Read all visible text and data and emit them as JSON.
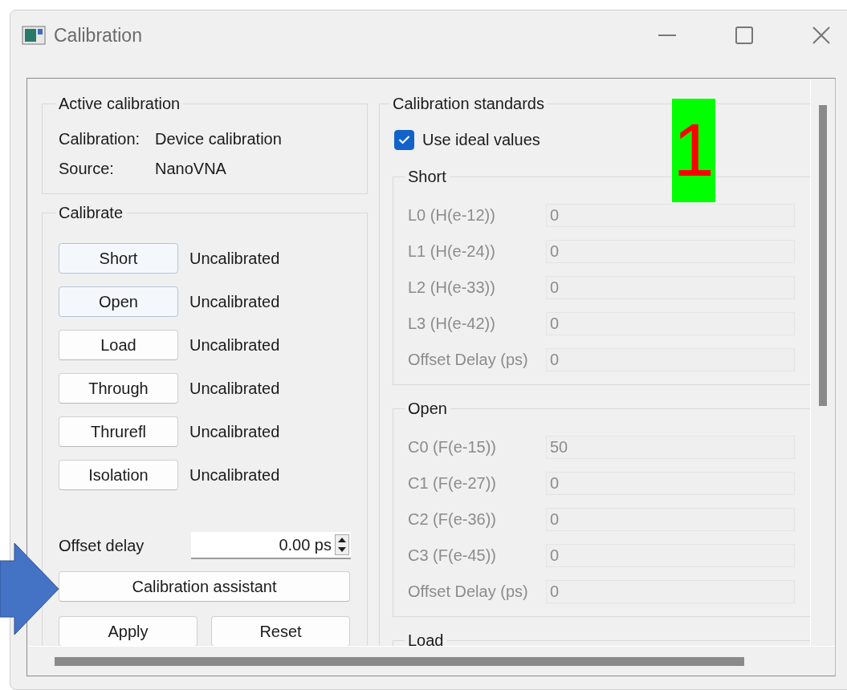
{
  "window": {
    "title": "Calibration"
  },
  "active_calibration": {
    "title": "Active calibration",
    "rows": [
      {
        "label": "Calibration:",
        "value": "Device calibration"
      },
      {
        "label": "Source:",
        "value": "NanoVNA"
      }
    ]
  },
  "calibrate": {
    "title": "Calibrate",
    "steps": [
      {
        "button": "Short",
        "status": "Uncalibrated",
        "highlighted": true
      },
      {
        "button": "Open",
        "status": "Uncalibrated",
        "highlighted": true
      },
      {
        "button": "Load",
        "status": "Uncalibrated",
        "highlighted": false
      },
      {
        "button": "Through",
        "status": "Uncalibrated",
        "highlighted": false
      },
      {
        "button": "Thrurefl",
        "status": "Uncalibrated",
        "highlighted": false
      },
      {
        "button": "Isolation",
        "status": "Uncalibrated",
        "highlighted": false
      }
    ],
    "offset_delay": {
      "label": "Offset delay",
      "value": "0.00 ps"
    },
    "assistant_button": "Calibration assistant",
    "buttons": [
      "Apply",
      "Reset"
    ]
  },
  "standards": {
    "title": "Calibration standards",
    "use_ideal": {
      "label": "Use ideal values",
      "checked": true
    },
    "groups": [
      {
        "title": "Short",
        "fields": [
          {
            "label": "L0 (H(e-12))",
            "value": "0",
            "disabled": true
          },
          {
            "label": "L1 (H(e-24))",
            "value": "0",
            "disabled": true
          },
          {
            "label": "L2 (H(e-33))",
            "value": "0",
            "disabled": true
          },
          {
            "label": "L3 (H(e-42))",
            "value": "0",
            "disabled": true
          },
          {
            "label": "Offset Delay (ps)",
            "value": "0",
            "disabled": true
          }
        ]
      },
      {
        "title": "Open",
        "fields": [
          {
            "label": "C0 (F(e-15))",
            "value": "50",
            "disabled": true
          },
          {
            "label": "C1 (F(e-27))",
            "value": "0",
            "disabled": true
          },
          {
            "label": "C2 (F(e-36))",
            "value": "0",
            "disabled": true
          },
          {
            "label": "C3 (F(e-45))",
            "value": "0",
            "disabled": true
          },
          {
            "label": "Offset Delay (ps)",
            "value": "0",
            "disabled": true
          }
        ]
      },
      {
        "title": "Load"
      }
    ]
  },
  "annotations": {
    "badge": "1"
  }
}
